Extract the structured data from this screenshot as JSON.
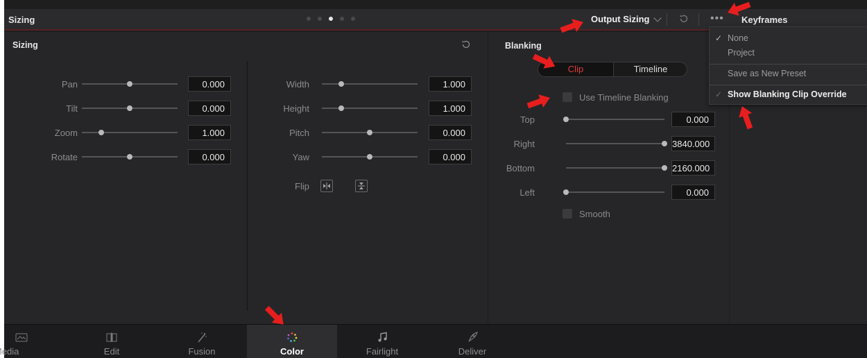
{
  "header": {
    "title": "Sizing",
    "output_sizing": "Output Sizing",
    "more": "•••",
    "keyframes": "Keyframes"
  },
  "sizing": {
    "title": "Sizing",
    "left_params": [
      {
        "label": "Pan",
        "value": "0.000",
        "level": 0.5
      },
      {
        "label": "Tilt",
        "value": "0.000",
        "level": 0.5
      },
      {
        "label": "Zoom",
        "value": "1.000",
        "level": 0.2
      },
      {
        "label": "Rotate",
        "value": "0.000",
        "level": 0.5
      }
    ],
    "right_params": [
      {
        "label": "Width",
        "value": "1.000",
        "level": 0.2
      },
      {
        "label": "Height",
        "value": "1.000",
        "level": 0.2
      },
      {
        "label": "Pitch",
        "value": "0.000",
        "level": 0.5
      },
      {
        "label": "Yaw",
        "value": "0.000",
        "level": 0.5
      }
    ],
    "flip_label": "Flip"
  },
  "blanking": {
    "title": "Blanking",
    "seg_clip": "Clip",
    "seg_timeline": "Timeline",
    "use_timeline_blanking": "Use Timeline Blanking",
    "params": [
      {
        "label": "Top",
        "value": "0.000",
        "level": 0.0
      },
      {
        "label": "Right",
        "value": "3840.000",
        "level": 1.0
      },
      {
        "label": "Bottom",
        "value": "2160.000",
        "level": 1.0
      },
      {
        "label": "Left",
        "value": "0.000",
        "level": 0.0
      }
    ],
    "smooth": "Smooth"
  },
  "menu": {
    "items": [
      {
        "label": "None",
        "checked": true
      },
      {
        "label": "Project",
        "checked": false
      },
      {
        "label": "Save as New Preset",
        "checked": false
      },
      {
        "label": "Show Blanking Clip Override",
        "checked": true
      }
    ]
  },
  "nav": {
    "tabs": [
      {
        "label": "Media",
        "icon": "media-icon"
      },
      {
        "label": "Edit",
        "icon": "edit-icon"
      },
      {
        "label": "Fusion",
        "icon": "fusion-icon"
      },
      {
        "label": "Color",
        "icon": "color-icon",
        "active": true
      },
      {
        "label": "Fairlight",
        "icon": "fairlight-icon"
      },
      {
        "label": "Deliver",
        "icon": "deliver-icon"
      }
    ]
  },
  "colors": {
    "accent_red": "#e03c3c",
    "annotation_arrow": "#e81e1e"
  }
}
